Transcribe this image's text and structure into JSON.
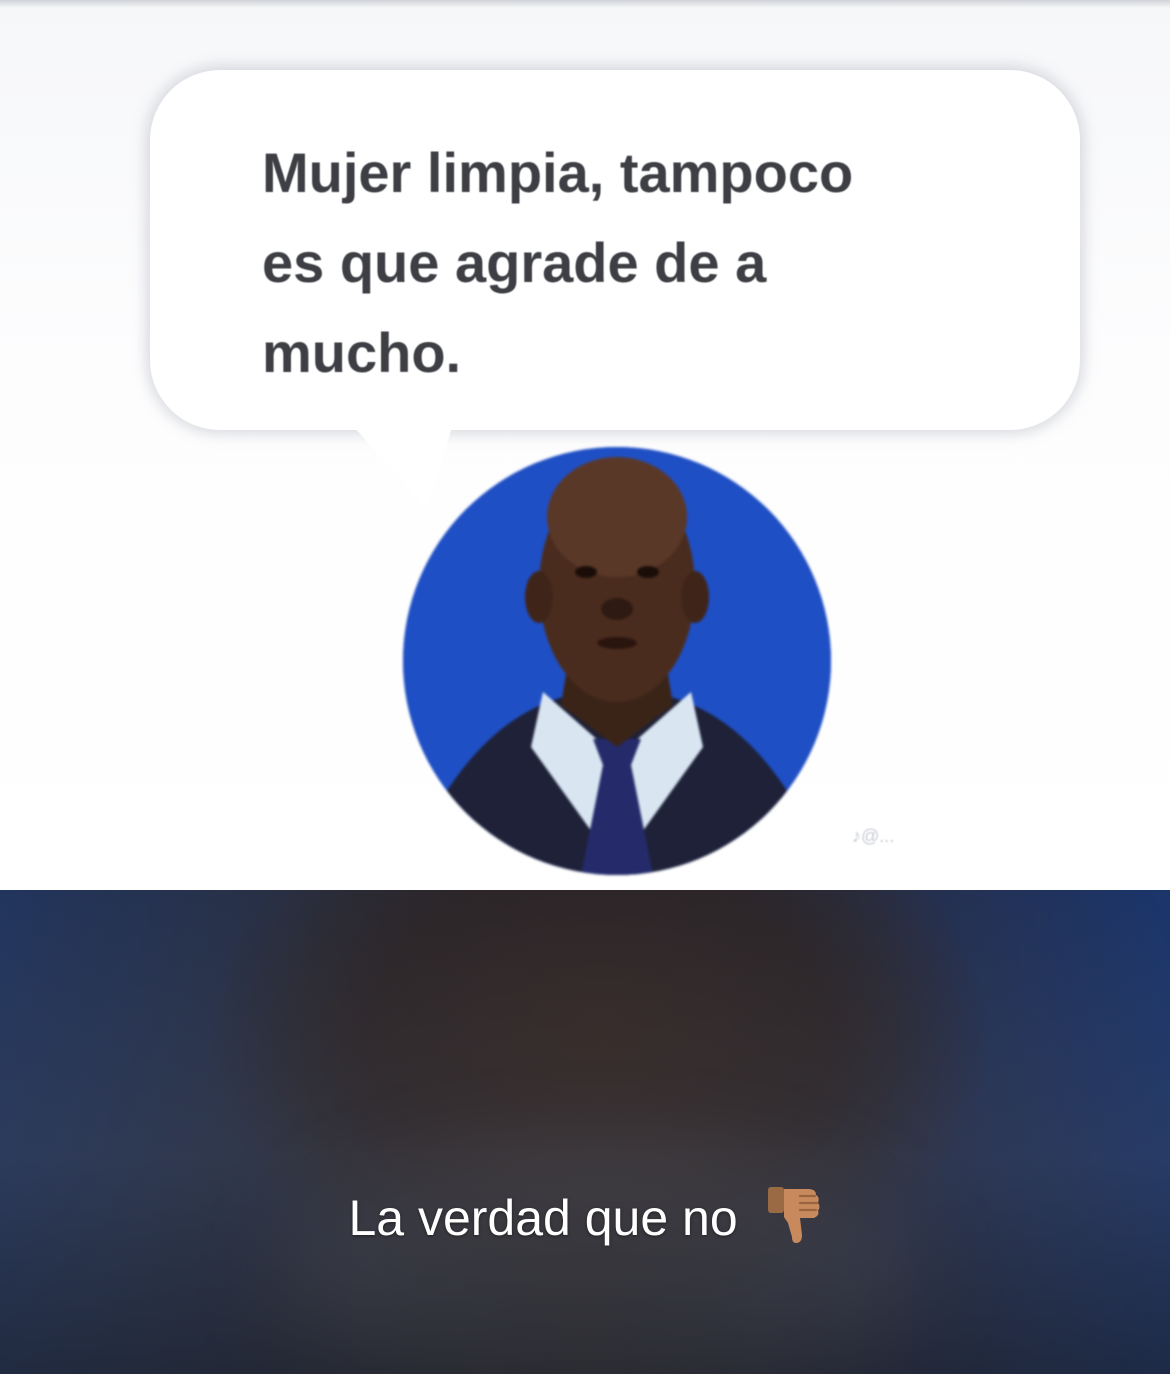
{
  "bubble": {
    "text": "Mujer limpia, tampoco\nes que agrade de a\nmucho."
  },
  "watermark": {
    "text": "♪@..."
  },
  "caption": {
    "text": "La verdad que no",
    "icon": "thumbs-down-icon"
  },
  "colors": {
    "avatar_background": "#1f4fc4",
    "bubble_text": "#3d3f44",
    "caption_text": "#ffffff"
  }
}
